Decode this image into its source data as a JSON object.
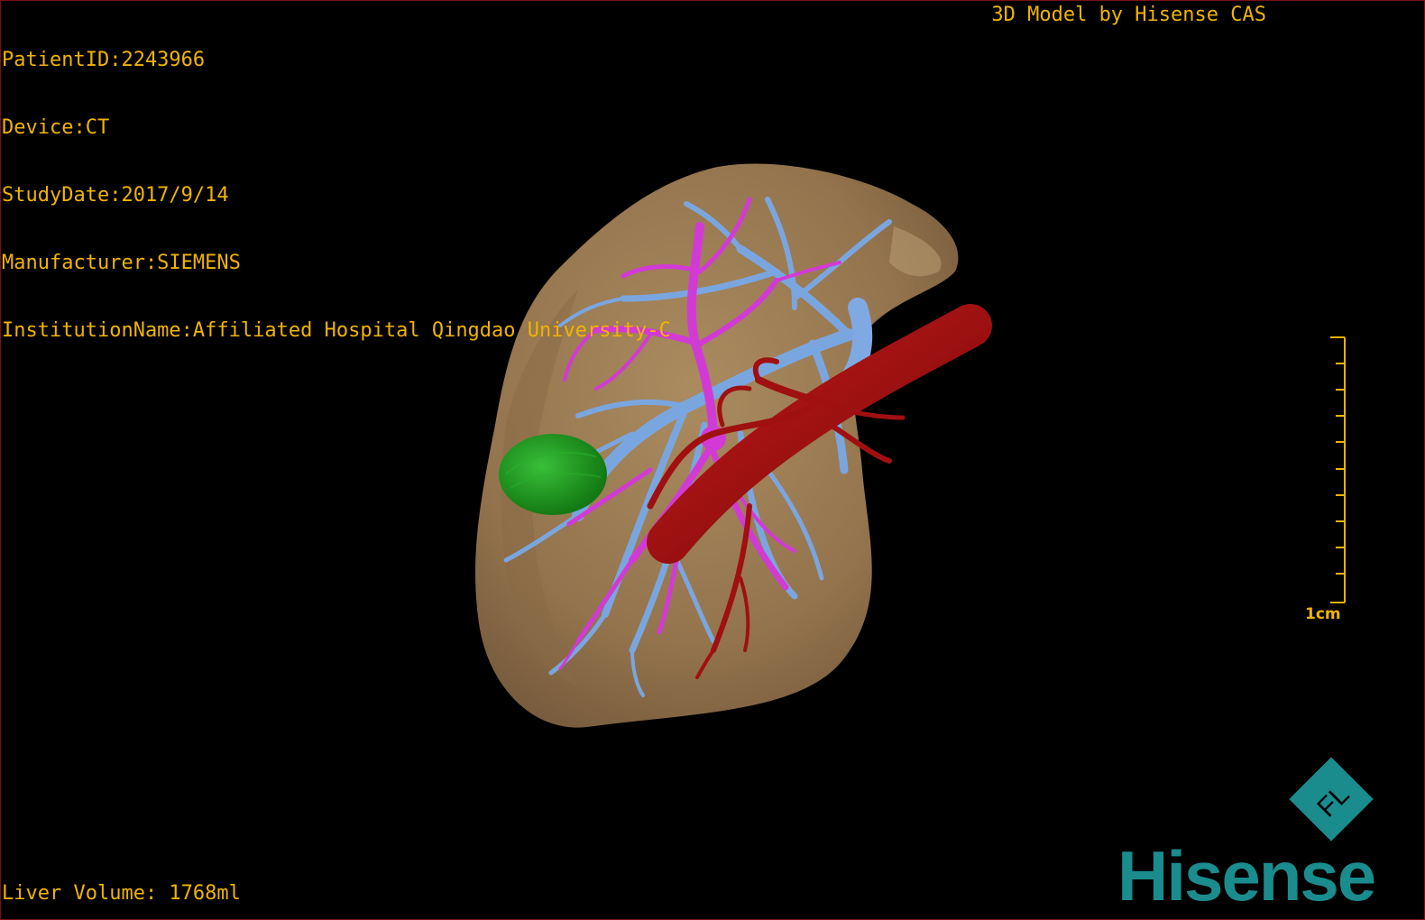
{
  "header": {
    "patient_id": "PatientID:2243966",
    "device": "Device:CT",
    "study_date": "StudyDate:2017/9/14",
    "manufacturer": "Manufacturer:SIEMENS",
    "institution": "InstitutionName:Affiliated Hospital Qingdao University-C",
    "model_credit": "3D Model by Hisense CAS"
  },
  "footer": {
    "liver_volume": "Liver Volume: 1768ml"
  },
  "scale": {
    "label": "1cm",
    "color": "#f0b400"
  },
  "logo": {
    "wordmark": "Hisense",
    "emblem": "FL",
    "color": "#1a8c8e"
  },
  "model_colors": {
    "liver": "#9c7b52",
    "hepatic_vein": "#7aa6e0",
    "portal_vein": "#d23ad6",
    "artery": "#a01010",
    "tumor": "#1fa01f"
  },
  "text_color": "#f0b400"
}
